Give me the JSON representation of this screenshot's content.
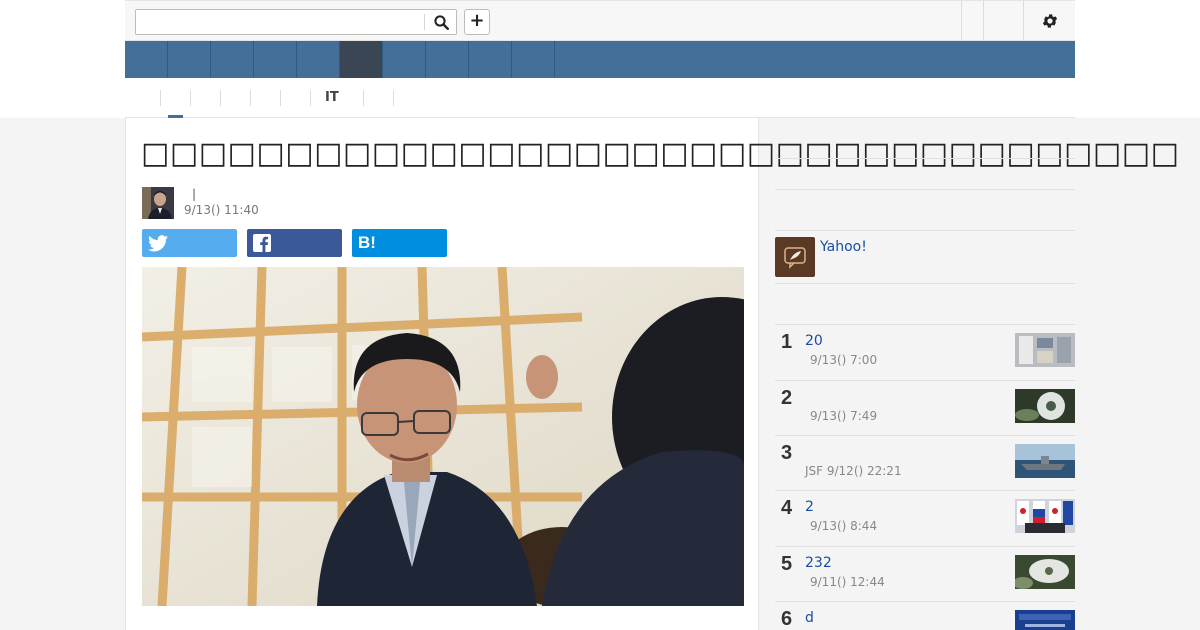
{
  "search": {
    "placeholder": "",
    "value": ""
  },
  "header": {
    "plus_label": "+"
  },
  "nav": {
    "items": [
      "",
      "",
      "",
      "",
      "",
      "",
      "",
      "",
      "",
      ""
    ],
    "active_index": 5
  },
  "subnav": {
    "items": [
      "",
      "",
      "",
      "",
      "",
      "IT",
      "",
      ""
    ]
  },
  "article": {
    "title": "□□□□□□□□□□□□□□□□□□□□□□□□□□□□□□□□□□□□",
    "author_separator": "|",
    "time": "9/13() 11:40",
    "share": {
      "twitter_icon": "twitter-icon",
      "facebook_icon": "facebook-icon",
      "hatena_label": "B!"
    }
  },
  "sidebar": {
    "yahoo_label": "Yahoo!",
    "ranking": [
      {
        "rank": "1",
        "title": "20",
        "meta": "9/13() 7:00"
      },
      {
        "rank": "2",
        "title": "",
        "meta": "9/13() 7:49"
      },
      {
        "rank": "3",
        "title": "",
        "meta": "JSF 9/12() 22:21"
      },
      {
        "rank": "4",
        "title": "2",
        "meta": "9/13() 8:44"
      },
      {
        "rank": "5",
        "title": "232",
        "meta": "9/11() 12:44"
      },
      {
        "rank": "6",
        "title": "d",
        "meta": ""
      }
    ]
  },
  "colors": {
    "nav": "#446f98",
    "nav_active": "#3b4654",
    "twitter": "#55acee",
    "facebook": "#3b5998",
    "hatena": "#008fde",
    "link": "#1a4da1"
  }
}
